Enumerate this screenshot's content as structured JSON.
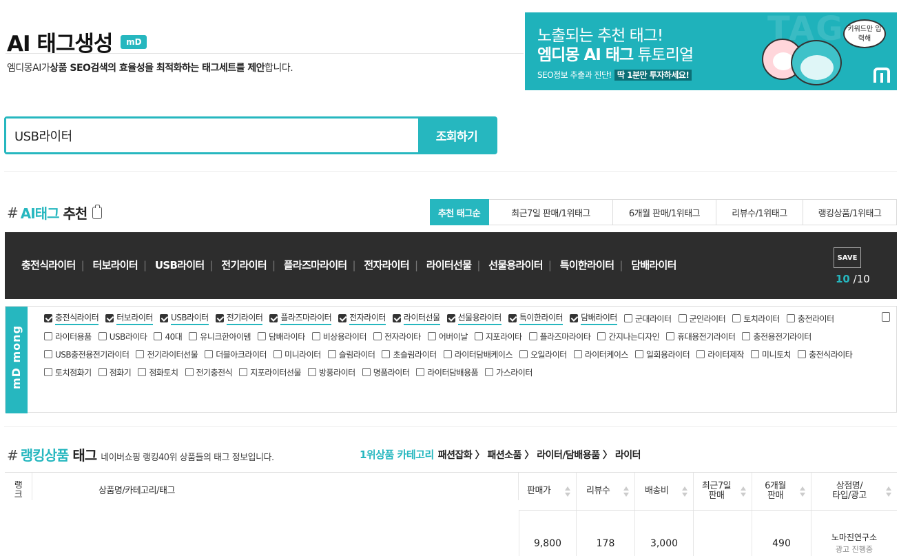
{
  "header": {
    "title": "AI 태그생성",
    "badge": "mD",
    "subtitle_parts": [
      "엠디몽AI가",
      "상품 SEO검색의 효율성을 최적화하는 태그세트를 제안",
      "합니다."
    ]
  },
  "banner": {
    "line1": "노출되는 추천 태그!",
    "line2_bold": "엠디몽 AI 태그",
    "line2_light": " 튜토리얼",
    "line3": "SEO정보 추출과 진단!",
    "line3_highlight": "딱 1분만 투자하세요!",
    "bubble": "키워드만 입력해",
    "bg_text": "TAG"
  },
  "search": {
    "value": "USB라이터",
    "button_label": "조회하기"
  },
  "ai_section": {
    "hash": "#",
    "title_accent": "AI태그",
    "title_rest": "추천",
    "tabs": [
      {
        "label": "추천 태그순",
        "active": true
      },
      {
        "label": "최근7일 판매/1위태그",
        "active": false
      },
      {
        "label": "6개월 판매/1위태그",
        "active": false
      },
      {
        "label": "리뷰수/1위태그",
        "active": false
      },
      {
        "label": "랭킹상품/1위태그",
        "active": false
      }
    ],
    "selected_tags": [
      "충전식라이터",
      "터보라이터",
      "USB라이터",
      "전기라이터",
      "플라즈마라이터",
      "전자라이터",
      "라이터선물",
      "선물용라이터",
      "특이한라이터",
      "담배라이터"
    ],
    "save_label": "SAVE",
    "count_selected": "10",
    "count_total": " /10",
    "side_logo": "mD mong"
  },
  "checkboxes": [
    {
      "label": "충전식라이터",
      "checked": true
    },
    {
      "label": "터보라이터",
      "checked": true
    },
    {
      "label": "USB라이터",
      "checked": true
    },
    {
      "label": "전기라이터",
      "checked": true
    },
    {
      "label": "플라즈마라이터",
      "checked": true
    },
    {
      "label": "전자라이터",
      "checked": true
    },
    {
      "label": "라이터선물",
      "checked": true
    },
    {
      "label": "선물용라이터",
      "checked": true
    },
    {
      "label": "특이한라이터",
      "checked": true
    },
    {
      "label": "담배라이터",
      "checked": true
    },
    {
      "label": "군대라이터",
      "checked": false
    },
    {
      "label": "군인라이터",
      "checked": false
    },
    {
      "label": "토치라이터",
      "checked": false
    },
    {
      "label": "충전라이터",
      "checked": false
    },
    {
      "label": "라이터용품",
      "checked": false
    },
    {
      "label": "USB라이타",
      "checked": false
    },
    {
      "label": "40대",
      "checked": false
    },
    {
      "label": "유니크한아이템",
      "checked": false
    },
    {
      "label": "담배라이타",
      "checked": false
    },
    {
      "label": "비상용라이터",
      "checked": false
    },
    {
      "label": "전자라이타",
      "checked": false
    },
    {
      "label": "어버이날",
      "checked": false
    },
    {
      "label": "지포라이타",
      "checked": false
    },
    {
      "label": "플라즈마라이타",
      "checked": false
    },
    {
      "label": "간지나는디자인",
      "checked": false
    },
    {
      "label": "휴대용전기라이터",
      "checked": false
    },
    {
      "label": "충전용전기라이터",
      "checked": false
    },
    {
      "label": "USB충전용전기라이터",
      "checked": false
    },
    {
      "label": "전기라이터선물",
      "checked": false
    },
    {
      "label": "더블아크라이터",
      "checked": false
    },
    {
      "label": "미니라이터",
      "checked": false
    },
    {
      "label": "슬림라이터",
      "checked": false
    },
    {
      "label": "초슬림라이터",
      "checked": false
    },
    {
      "label": "라이터담배케이스",
      "checked": false
    },
    {
      "label": "오일라이터",
      "checked": false
    },
    {
      "label": "라이터케이스",
      "checked": false
    },
    {
      "label": "일회용라이터",
      "checked": false
    },
    {
      "label": "라이터제작",
      "checked": false
    },
    {
      "label": "미니토치",
      "checked": false
    },
    {
      "label": "충전식라이타",
      "checked": false
    },
    {
      "label": "토치점화기",
      "checked": false
    },
    {
      "label": "점화기",
      "checked": false
    },
    {
      "label": "점화토치",
      "checked": false
    },
    {
      "label": "전기충전식",
      "checked": false
    },
    {
      "label": "지포라이터선물",
      "checked": false
    },
    {
      "label": "방풍라이터",
      "checked": false
    },
    {
      "label": "명품라이터",
      "checked": false
    },
    {
      "label": "라이터담배용품",
      "checked": false
    },
    {
      "label": "가스라이터",
      "checked": false
    }
  ],
  "ranking": {
    "hash": "#",
    "title_accent": "랭킹상품",
    "title_rest": "태그",
    "desc": "네이버쇼핑 랭킹40위 상품들의 태그 정보입니다.",
    "category_label": "1위상품 카테고리",
    "category_path": "패션잡화 〉 패션소품 〉 라이터/담배용품 〉 라이터",
    "columns": {
      "rank": "랭크",
      "product": "상품명/카테고리/태그",
      "price": "판매가",
      "reviews": "리뷰수",
      "shipping": "배송비",
      "sales7_line1": "최근7일",
      "sales7_line2": "판매",
      "sales6_line1": "6개월",
      "sales6_line2": "판매",
      "shop_line1": "상점명/",
      "shop_line2": "타입/광고"
    },
    "rows": [
      {
        "price": "9,800",
        "reviews": "178",
        "shipping": "3,000",
        "sales7": "",
        "sales6": "490",
        "shop": "노마진연구소",
        "ad": "광고 진행중"
      }
    ]
  }
}
